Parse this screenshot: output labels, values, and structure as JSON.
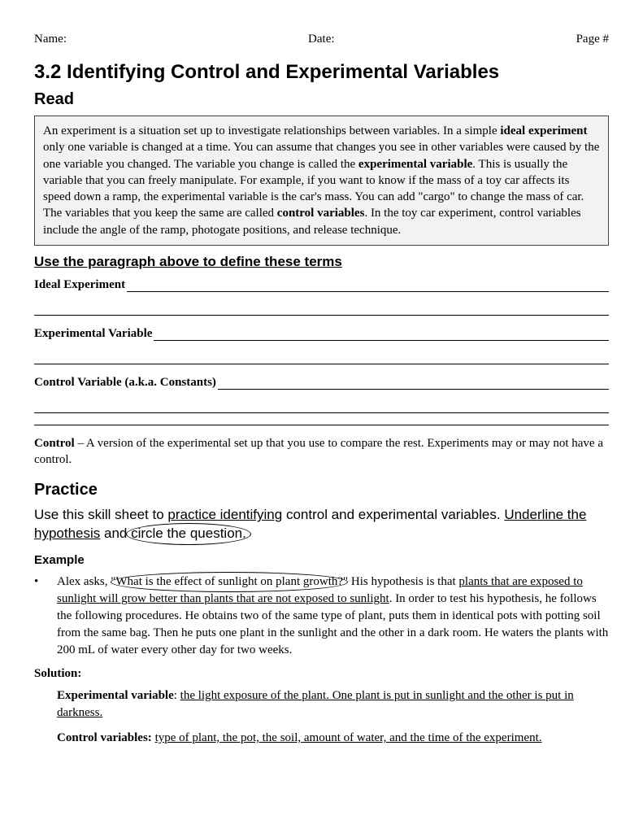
{
  "header": {
    "name": "Name:",
    "date": "Date:",
    "page": "Page #"
  },
  "title": "3.2 Identifying Control and Experimental Variables",
  "read": {
    "heading": "Read",
    "p1a": "An experiment is a situation set up to investigate relationships between variables. In a simple ",
    "ideal": "ideal experiment",
    "p1b": " only one variable is changed at a time. You can assume that changes you see in other variables were caused by the one variable you changed. The variable you change is called the ",
    "expvar": "experimental variable",
    "p1c": ". This is usually the variable that you can freely manipulate. For example, if you want to know if the mass of a toy car affects its speed down a ramp, the experimental variable is the car's mass. You can add \"cargo\" to change the mass of car. The variables that you keep the same are called ",
    "ctrlvar": "control variables",
    "p1d": ". In the toy car experiment, control variables include the angle of the ramp, photogate positions, and release technique."
  },
  "define": {
    "heading": "Use the paragraph above to define these terms",
    "term1": "Ideal Experiment",
    "term2": "Experimental Variable ",
    "term3": "Control Variable (a.k.a. Constants) "
  },
  "controlDef": {
    "bold": "Control",
    "rest": " – A version of the experimental set up that you use to compare the rest.  Experiments may or may not have a control."
  },
  "practice": {
    "heading": "Practice",
    "instrA": "Use this skill sheet to ",
    "instrU1": "practice identifying",
    "instrB": " control and experimental variables. ",
    "instrU2": "Underline the hypothesis",
    "instrC": " and ",
    "instrCircle": "circle the question.",
    "exampleH": "Example",
    "exA": "Alex asks, \"",
    "exQ": "What is the effect of sunlight on plant growth?",
    "exB": "\" His hypothesis is that ",
    "exHyp": "plants that are exposed to sunlight will grow better than plants that are not exposed to sunlight",
    "exC": ". In order to test his hypothesis, he follows the following procedures. He obtains two of the same type of plant, puts them in identical pots with potting soil from the same bag. Then he puts one plant in the sunlight and the other in a dark room. He waters the plants with 200 mL of water every other day for two weeks.",
    "solH": "Solution:",
    "sol1bold": "Experimental variable",
    "sol1rest": ": ",
    "sol1u": "the light exposure of the plant. One plant is put in sunlight and the other is put in darkness.",
    "sol2bold": "Control variables:",
    "sol2rest": " ",
    "sol2u": "type of plant, the pot, the soil, amount of water, and the time of the experiment."
  }
}
